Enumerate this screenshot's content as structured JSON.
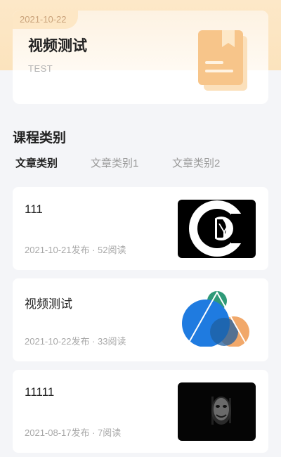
{
  "featured": {
    "date": "2021-10-22",
    "title": "视频测试",
    "subtitle": "TEST",
    "icon": "book-icon"
  },
  "section": {
    "title": "课程类别"
  },
  "tabs": [
    {
      "label": "文章类别",
      "active": true
    },
    {
      "label": "文章类别1",
      "active": false
    },
    {
      "label": "文章类别2",
      "active": false
    }
  ],
  "articles": [
    {
      "title": "111",
      "meta": "2021-10-21发布 · 52阅读",
      "thumb": "cdy-logo"
    },
    {
      "title": "视频测试",
      "meta": "2021-10-22发布 · 33阅读",
      "thumb": "color-circles"
    },
    {
      "title": "11111",
      "meta": "2021-08-17发布 · 7阅读",
      "thumb": "dark-face"
    }
  ],
  "colors": {
    "accent": "#f5b56a",
    "header_bg": "#fde8c8",
    "date_tag_text": "#c9a27a"
  }
}
